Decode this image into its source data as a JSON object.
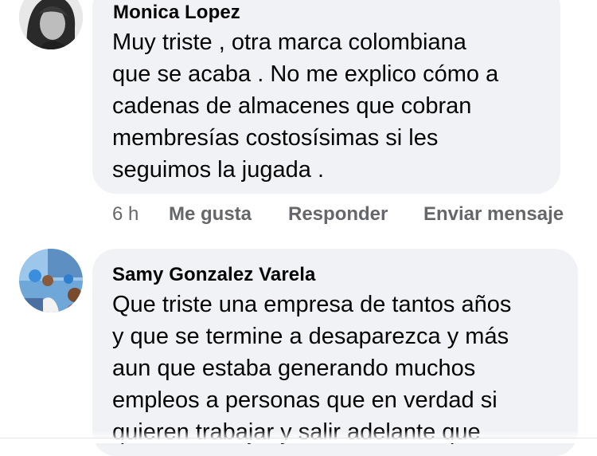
{
  "comments": [
    {
      "author": "Monica Lopez",
      "lines": [
        "Muy triste , otra marca colombiana",
        "que se acaba . No me explico cómo a",
        "cadenas de almacenes que cobran",
        "membresías costosísimas si les",
        "seguimos la jugada ."
      ],
      "time": "6 h",
      "like_label": "Me gusta",
      "reply_label": "Responder",
      "message_label": "Enviar mensaje"
    },
    {
      "author": "Samy Gonzalez Varela",
      "lines": [
        "Que triste una empresa de tantos años",
        "y que se termine a desaparezca y más",
        "aun que estaba generando muchos",
        "empleos a personas que en verdad si",
        "quieren trabajar y salir adelante que"
      ]
    }
  ],
  "colors": {
    "bubble": "#f0f2f5",
    "text": "#050505",
    "secondary": "#65676b"
  }
}
